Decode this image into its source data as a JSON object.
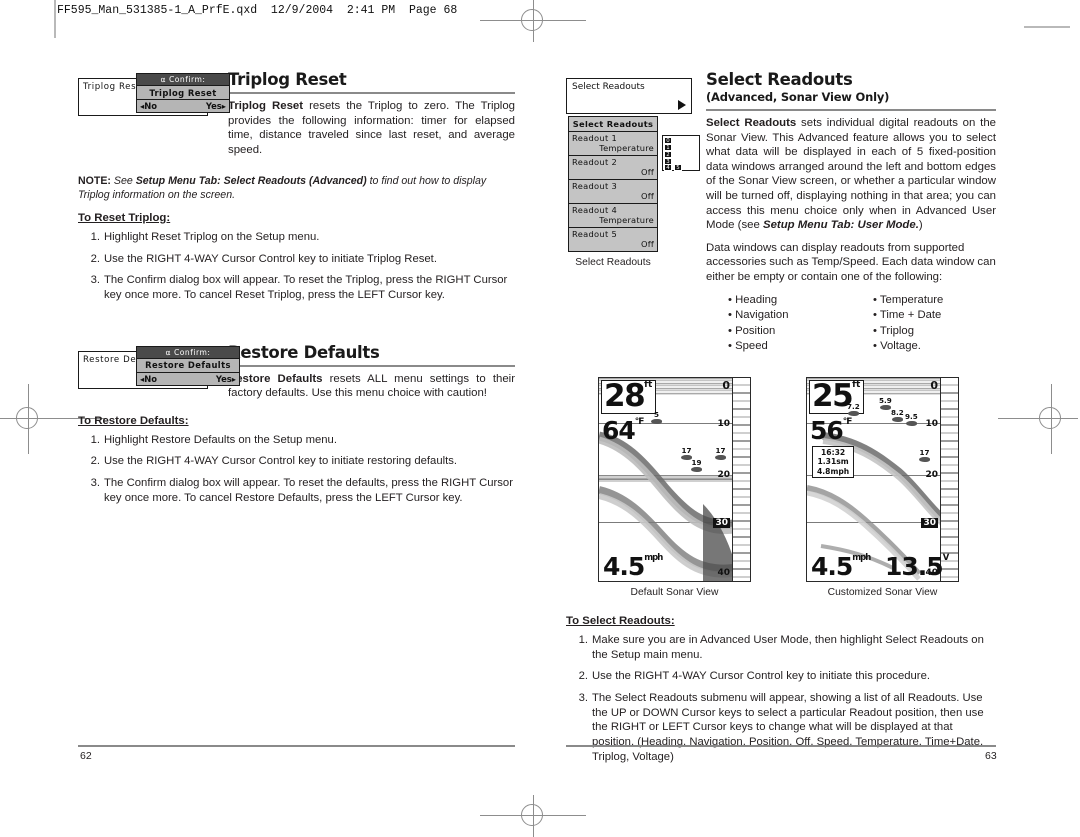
{
  "prepress": {
    "slug": "FF595_Man_531385-1_A_PrfE.qxd  12/9/2004  2:41 PM  Page 68"
  },
  "left_page": {
    "page_number": "62",
    "sections": [
      {
        "title": "Triplog Reset",
        "menu_mock": {
          "strip_label": "Triplog Reset",
          "confirm_header": "Confirm:",
          "confirm_title": "Triplog Reset",
          "no_label": "No",
          "yes_label": "Yes"
        },
        "body": "resets the Triplog to zero. The Triplog provides the following information: timer for elapsed time, distance traveled since last reset, and average speed.",
        "body_lead": "Triplog Reset",
        "note": {
          "label": "NOTE:",
          "pre": "See ",
          "ref": "Setup Menu Tab: Select Readouts (Advanced)",
          "post": " to find out how to display Triplog information on the screen."
        },
        "procedure_title": "To Reset Triplog:",
        "steps": [
          "Highlight Reset Triplog on the Setup menu.",
          "Use the RIGHT 4-WAY Cursor Control key to initiate Triplog Reset.",
          "The Confirm dialog box will appear. To reset the Triplog, press the RIGHT Cursor key once more. To cancel Reset Triplog, press the LEFT Cursor key."
        ]
      },
      {
        "title": "Restore Defaults",
        "menu_mock": {
          "strip_label": "Restore Defaults",
          "confirm_header": "Confirm:",
          "confirm_title": "Restore Defaults",
          "no_label": "No",
          "yes_label": "Yes"
        },
        "body_lead": "Restore Defaults",
        "body": "resets ALL menu settings to their factory defaults. Use this menu choice with caution!",
        "procedure_title": "To Restore Defaults:",
        "steps": [
          "Highlight Restore Defaults on the Setup menu.",
          "Use the RIGHT 4-WAY Cursor Control key to initiate restoring defaults.",
          "The Confirm dialog box will appear. To reset the defaults,  press the RIGHT Cursor key once more. To cancel Restore Defaults, press the LEFT Cursor key."
        ]
      }
    ]
  },
  "right_page": {
    "page_number": "63",
    "title": "Select Readouts",
    "subtitle": "(Advanced, Sonar View Only)",
    "menu_strip": {
      "label": "Select Readouts",
      "arrow_icon": "right-arrow-icon"
    },
    "submenu": {
      "title": "Select Readouts",
      "rows": [
        {
          "key": "Readout 1",
          "value": "Temperature"
        },
        {
          "key": "Readout 2",
          "value": "Off"
        },
        {
          "key": "Readout 3",
          "value": "Off"
        },
        {
          "key": "Readout 4",
          "value": "Temperature"
        },
        {
          "key": "Readout 5",
          "value": "Off"
        }
      ],
      "caption": "Select Readouts",
      "position_diagram": [
        "0",
        "1",
        "2",
        "3",
        "4",
        "5"
      ]
    },
    "paragraph1_lead": "Select Readouts",
    "paragraph1": "sets individual digital readouts on the Sonar View. This Advanced feature allows you to select what data will be displayed in each of 5 fixed-position data windows arranged around the left and bottom edges of the Sonar View screen, or whether a particular window will be turned off, displaying nothing in that area; you can access this menu choice only when in Advanced User Mode (see ",
    "paragraph1_ref": "Setup Menu Tab: User Mode.",
    "paragraph1_tail": ")",
    "paragraph2": "Data windows can display readouts from supported accessories such as Temp/Speed. Each data window can either be empty or contain one of the following:",
    "readout_options_left": [
      "Heading",
      "Navigation",
      "Position",
      "Speed"
    ],
    "readout_options_right": [
      "Temperature",
      "Time + Date",
      "Triplog",
      "Voltage."
    ],
    "sonar_views": [
      {
        "caption": "Default Sonar View",
        "depth": "28",
        "depth_unit": "ft",
        "temperature": "64",
        "temperature_unit": "°F",
        "speed": "4.5",
        "speed_unit": "mph",
        "scale_labels": [
          "0",
          "10",
          "20",
          "30",
          "40"
        ],
        "fish_depths": [
          "5",
          "17",
          "19",
          "17"
        ]
      },
      {
        "caption": "Customized Sonar View",
        "depth": "25",
        "depth_unit": "ft",
        "temperature": "56",
        "temperature_unit": "°F",
        "speed": "4.5",
        "speed_unit": "mph",
        "voltage": "13.5",
        "voltage_unit": "V",
        "triplog": {
          "time": "16:32",
          "distance": "1.31sm",
          "avg_speed": "4.8mph"
        },
        "scale_labels": [
          "0",
          "10",
          "20",
          "30",
          "40"
        ],
        "fish_depths": [
          "7.2",
          "5.9",
          "8.2",
          "9.5",
          "17"
        ]
      }
    ],
    "procedure_title": "To Select Readouts:",
    "steps": [
      "Make sure you are in Advanced User Mode, then highlight Select Readouts on the Setup main menu.",
      "Use the RIGHT 4-WAY Cursor Control key to initiate this procedure.",
      "The Select Readouts submenu will appear, showing a list of all Readouts. Use the UP or DOWN Cursor keys to select a particular Readout position, then use the RIGHT or LEFT Cursor keys to change what will be displayed at that position. (Heading, Navigation, Position, Off, Speed, Temperature, Time+Date, Triplog, Voltage)"
    ]
  }
}
